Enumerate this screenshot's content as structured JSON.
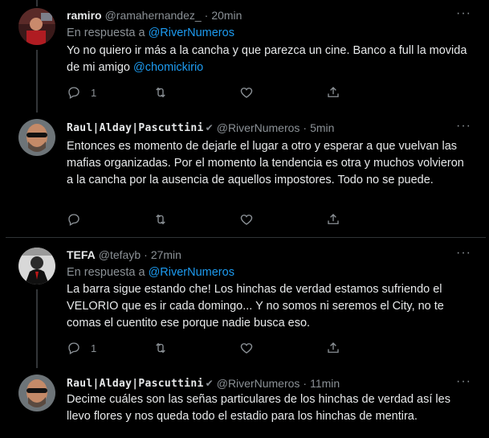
{
  "tweets": [
    {
      "name": "ramiro",
      "handle": "@ramahernandez_",
      "time": "20min",
      "reply_prefix": "En respuesta a",
      "reply_to": "@RiverNumeros",
      "text": "Yo no quiero ir más a la cancha y que parezca un cine. Banco a full la movida de mi amigo ",
      "link": "@chomickirio",
      "replies": "1",
      "likes": ""
    },
    {
      "name": "Raul|Alday|Pascuttini",
      "handle": "@RiverNumeros",
      "time": "5min",
      "text": "Entonces es momento de dejarle el lugar a otro y esperar a que vuelvan las mafias organizadas. Por el momento la tendencia es otra y muchos volvieron a la cancha por la ausencia de aquellos impostores. Todo no se puede.",
      "replies": "",
      "likes": ""
    },
    {
      "name": "TEFA",
      "handle": "@tefayb",
      "time": "27min",
      "reply_prefix": "En respuesta a",
      "reply_to": "@RiverNumeros",
      "text": "La barra sigue estando che! Los hinchas de verdad estamos sufriendo el VELORIO que es ir cada domingo... Y no somos ni seremos el City, no te comas el cuentito ese porque nadie busca eso.",
      "replies": "1",
      "likes": ""
    },
    {
      "name": "Raul|Alday|Pascuttini",
      "handle": "@RiverNumeros",
      "time": "11min",
      "text": "Decime cuáles son las señas particulares de los hinchas de verdad así les llevo flores y nos queda todo el estadio para los hinchas de mentira."
    }
  ],
  "separator": "·",
  "more_glyph": "···",
  "icons": [
    "reply-icon",
    "retweet-icon",
    "like-icon",
    "share-icon",
    "more-icon",
    "verified-icon"
  ],
  "colors": {
    "background": "#000000",
    "link": "#1d9bf0",
    "muted": "#8b9196",
    "text": "#e7e9ea"
  }
}
